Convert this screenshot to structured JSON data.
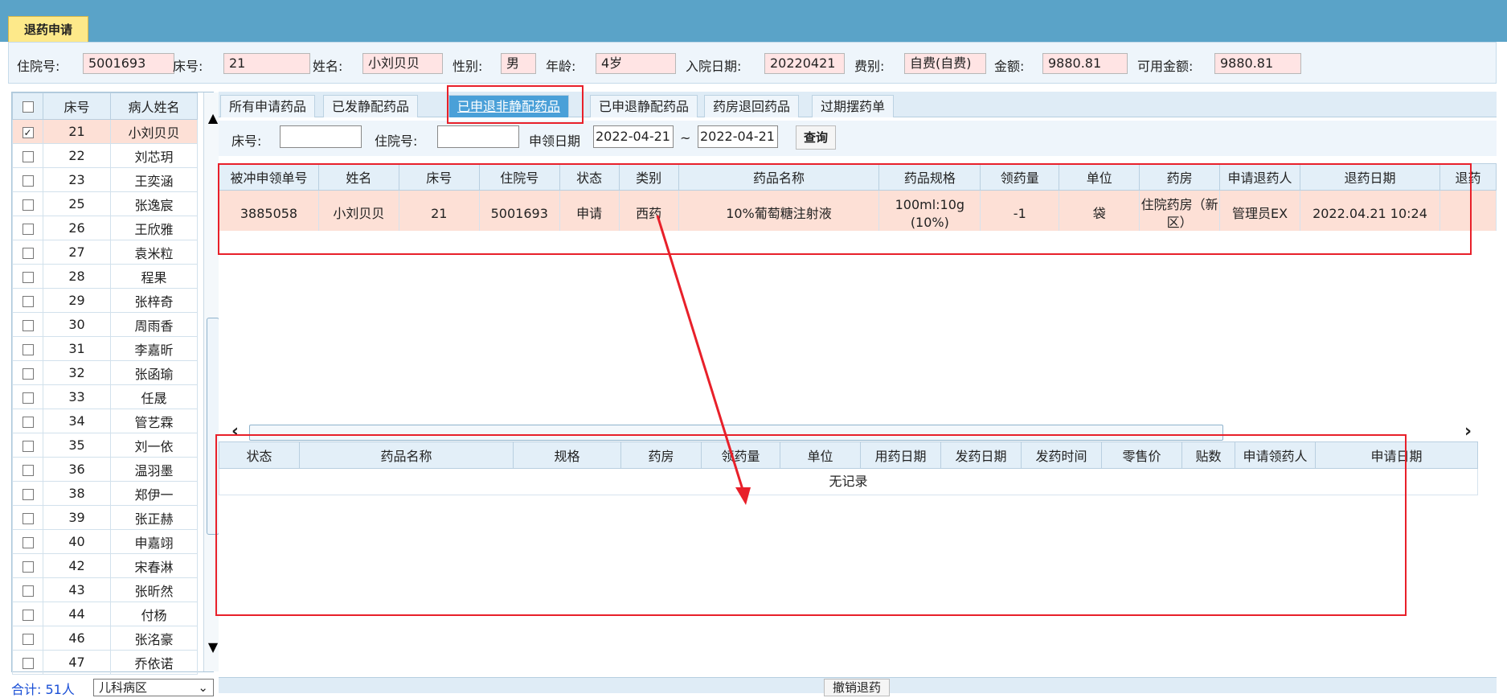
{
  "window": {
    "tab_title": "退药申请"
  },
  "patient": {
    "admission_no_label": "住院号:",
    "admission_no": "5001693",
    "bed_label": "床号:",
    "bed": "21",
    "name_label": "姓名:",
    "name": "小刘贝贝",
    "gender_label": "性别:",
    "gender": "男",
    "age_label": "年龄:",
    "age": "4岁",
    "admit_date_label": "入院日期:",
    "admit_date": "20220421",
    "fee_type_label": "费别:",
    "fee_type": "自费(自费)",
    "amount_label": "金额:",
    "amount": "9880.81",
    "available_label": "可用金额:",
    "available": "9880.81"
  },
  "patient_list": {
    "headers": [
      "",
      "床号",
      "病人姓名"
    ],
    "rows": [
      {
        "bed": "21",
        "name": "小刘贝贝",
        "checked": true
      },
      {
        "bed": "22",
        "name": "刘芯玥",
        "checked": false
      },
      {
        "bed": "23",
        "name": "王奕涵",
        "checked": false
      },
      {
        "bed": "25",
        "name": "张逸宸",
        "checked": false
      },
      {
        "bed": "26",
        "name": "王欣雅",
        "checked": false
      },
      {
        "bed": "27",
        "name": "袁米粒",
        "checked": false
      },
      {
        "bed": "28",
        "name": "程果",
        "checked": false
      },
      {
        "bed": "29",
        "name": "张梓奇",
        "checked": false
      },
      {
        "bed": "30",
        "name": "周雨香",
        "checked": false
      },
      {
        "bed": "31",
        "name": "李嘉昕",
        "checked": false
      },
      {
        "bed": "32",
        "name": "张函瑜",
        "checked": false
      },
      {
        "bed": "33",
        "name": "任晟",
        "checked": false
      },
      {
        "bed": "34",
        "name": "管艺霖",
        "checked": false
      },
      {
        "bed": "35",
        "name": "刘一依",
        "checked": false
      },
      {
        "bed": "36",
        "name": "温羽墨",
        "checked": false
      },
      {
        "bed": "38",
        "name": "郑伊一",
        "checked": false
      },
      {
        "bed": "39",
        "name": "张正赫",
        "checked": false
      },
      {
        "bed": "40",
        "name": "申嘉翊",
        "checked": false
      },
      {
        "bed": "42",
        "name": "宋春淋",
        "checked": false
      },
      {
        "bed": "43",
        "name": "张昕然",
        "checked": false
      },
      {
        "bed": "44",
        "name": "付杨",
        "checked": false
      },
      {
        "bed": "46",
        "name": "张洺豪",
        "checked": false
      },
      {
        "bed": "47",
        "name": "乔依诺",
        "checked": false
      }
    ],
    "total_label": "合计: 51人",
    "ward_select": "儿科病区"
  },
  "subtabs": [
    {
      "label": "所有申请药品",
      "active": false
    },
    {
      "label": "已发静配药品",
      "active": false
    },
    {
      "label": "已申退非静配药品",
      "active": true
    },
    {
      "label": "已申退静配药品",
      "active": false
    },
    {
      "label": "药房退回药品",
      "active": false
    },
    {
      "label": "过期摆药单",
      "active": false
    }
  ],
  "query": {
    "bed_label": "床号:",
    "bed_value": "",
    "admission_label": "住院号:",
    "admission_value": "",
    "date_label": "申领日期",
    "date_from": "2022-04-21",
    "date_sep": "~",
    "date_to": "2022-04-21",
    "query_button": "查询"
  },
  "upper_grid": {
    "headers": [
      "被冲申领单号",
      "姓名",
      "床号",
      "住院号",
      "状态",
      "类别",
      "药品名称",
      "药品规格",
      "领药量",
      "单位",
      "药房",
      "申请退药人",
      "退药日期",
      "退药"
    ],
    "rows": [
      [
        "3885058",
        "小刘贝贝",
        "21",
        "5001693",
        "申请",
        "西药",
        "10%葡萄糖注射液",
        "100ml:10g (10%)",
        "-1",
        "袋",
        "住院药房（新区）",
        "管理员EX",
        "2022.04.21 10:24",
        ""
      ]
    ]
  },
  "lower_grid": {
    "headers": [
      "状态",
      "药品名称",
      "规格",
      "药房",
      "领药量",
      "单位",
      "用药日期",
      "发药日期",
      "发药时间",
      "零售价",
      "贴数",
      "申请领药人",
      "申请日期"
    ],
    "empty_text": "无记录"
  },
  "bottom": {
    "revoke_button": "撤销退药"
  },
  "colors": {
    "accent": "#4aa0d8",
    "highlight_row": "#fde0d6",
    "annotation": "#e8202a",
    "top_band": "#5aa3c8"
  }
}
